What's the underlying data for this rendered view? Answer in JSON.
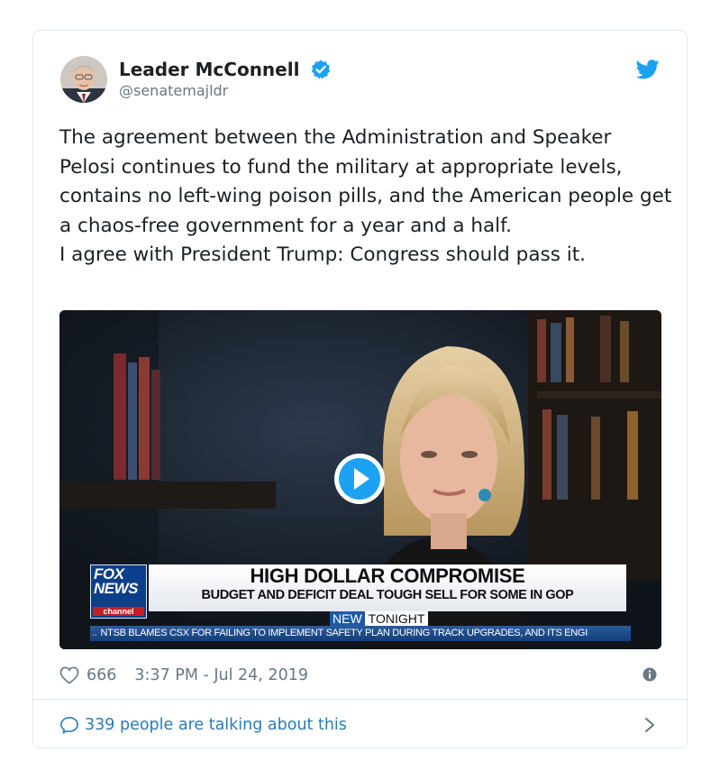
{
  "author": {
    "display_name": "Leader McConnell",
    "handle": "@senatemajldr",
    "verified": true,
    "avatar_icon": "avatar-photo"
  },
  "brand_icon": "twitter-bird-icon",
  "colors": {
    "twitter_blue": "#1da1f2",
    "link_blue": "#2b7bb9",
    "muted_gray": "#697882",
    "text": "#1c2022"
  },
  "tweet": {
    "text_line1": "The agreement between the Administration and Speaker Pelosi continues to fund the military at appropriate levels, contains no left-wing poison pills, and the American people get a chaos-free government for a year and a half.",
    "text_line2": "I agree with President Trump: Congress should pass it."
  },
  "video": {
    "play_icon": "play-icon",
    "lower_third": {
      "network_logo_top": "FOX",
      "network_logo_mid": "NEWS",
      "network_logo_bottom": "channel",
      "headline": "HIGH DOLLAR COMPROMISE",
      "subhead": "BUDGET AND DEFICIT DEAL TOUGH SELL FOR SOME IN GOP",
      "badge_new": "NEW",
      "badge_tonight": "TONIGHT",
      "ticker_prefix": "..",
      "ticker": "NTSB BLAMES CSX FOR FAILING TO IMPLEMENT SAFETY PLAN DURING TRACK UPGRADES, AND ITS ENGI"
    }
  },
  "meta": {
    "likes": "666",
    "timestamp": "3:37 PM - Jul 24, 2019",
    "info_icon": "info-icon"
  },
  "footer": {
    "talking_text": "339 people are talking about this",
    "chevron_icon": "chevron-right-icon"
  }
}
